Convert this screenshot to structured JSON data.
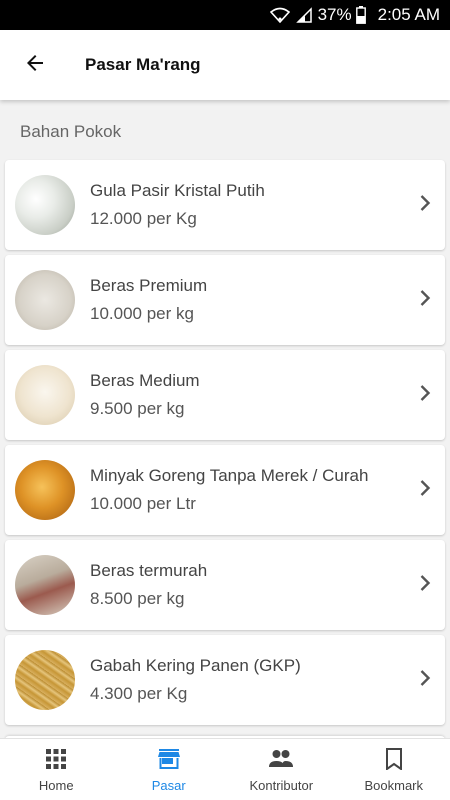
{
  "status_bar": {
    "battery": "37%",
    "time": "2:05 AM"
  },
  "header": {
    "title": "Pasar Ma'rang",
    "back_icon": "arrow-left-icon"
  },
  "section": {
    "title": "Bahan Pokok"
  },
  "items": [
    {
      "name": "Gula Pasir Kristal Putih",
      "price": "12.000 per Kg"
    },
    {
      "name": "Beras Premium",
      "price": "10.000 per kg"
    },
    {
      "name": "Beras Medium",
      "price": "9.500 per kg"
    },
    {
      "name": "Minyak Goreng Tanpa Merek / Curah",
      "price": "10.000 per Ltr"
    },
    {
      "name": "Beras termurah",
      "price": "8.500 per kg"
    },
    {
      "name": "Gabah Kering Panen (GKP)",
      "price": "4.300 per Kg"
    }
  ],
  "bottom_nav": [
    {
      "label": "Home",
      "icon": "grid-icon",
      "active": false
    },
    {
      "label": "Pasar",
      "icon": "store-icon",
      "active": true
    },
    {
      "label": "Kontributor",
      "icon": "people-icon",
      "active": false
    },
    {
      "label": "Bookmark",
      "icon": "bookmark-icon",
      "active": false
    }
  ],
  "colors": {
    "accent": "#1e88e5",
    "background": "#f2f2f2",
    "statusbar": "#000000"
  }
}
